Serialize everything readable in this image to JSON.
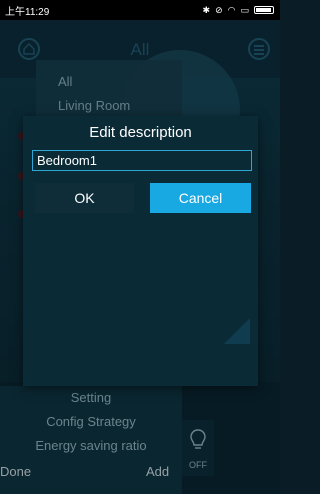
{
  "status_bar": {
    "time": "上午11:29",
    "icons": [
      "bluetooth-icon",
      "no-sound-icon",
      "wifi-icon",
      "sim-icon",
      "battery-icon"
    ]
  },
  "header": {
    "title": "All"
  },
  "dropdown": {
    "items": [
      "All",
      "Living Room"
    ]
  },
  "menu": {
    "setting": "Setting",
    "config_strategy": "Config Strategy",
    "energy_saving_ratio": "Energy saving ratio",
    "done": "Done",
    "add": "Add"
  },
  "device": {
    "state": "OFF"
  },
  "dialog": {
    "title": "Edit description",
    "input_value": "Bedroom1",
    "ok_label": "OK",
    "cancel_label": "Cancel"
  },
  "colors": {
    "accent": "#18a8e2",
    "dialog_bg": "#0a2a36",
    "input_border": "#2ea6d6"
  }
}
